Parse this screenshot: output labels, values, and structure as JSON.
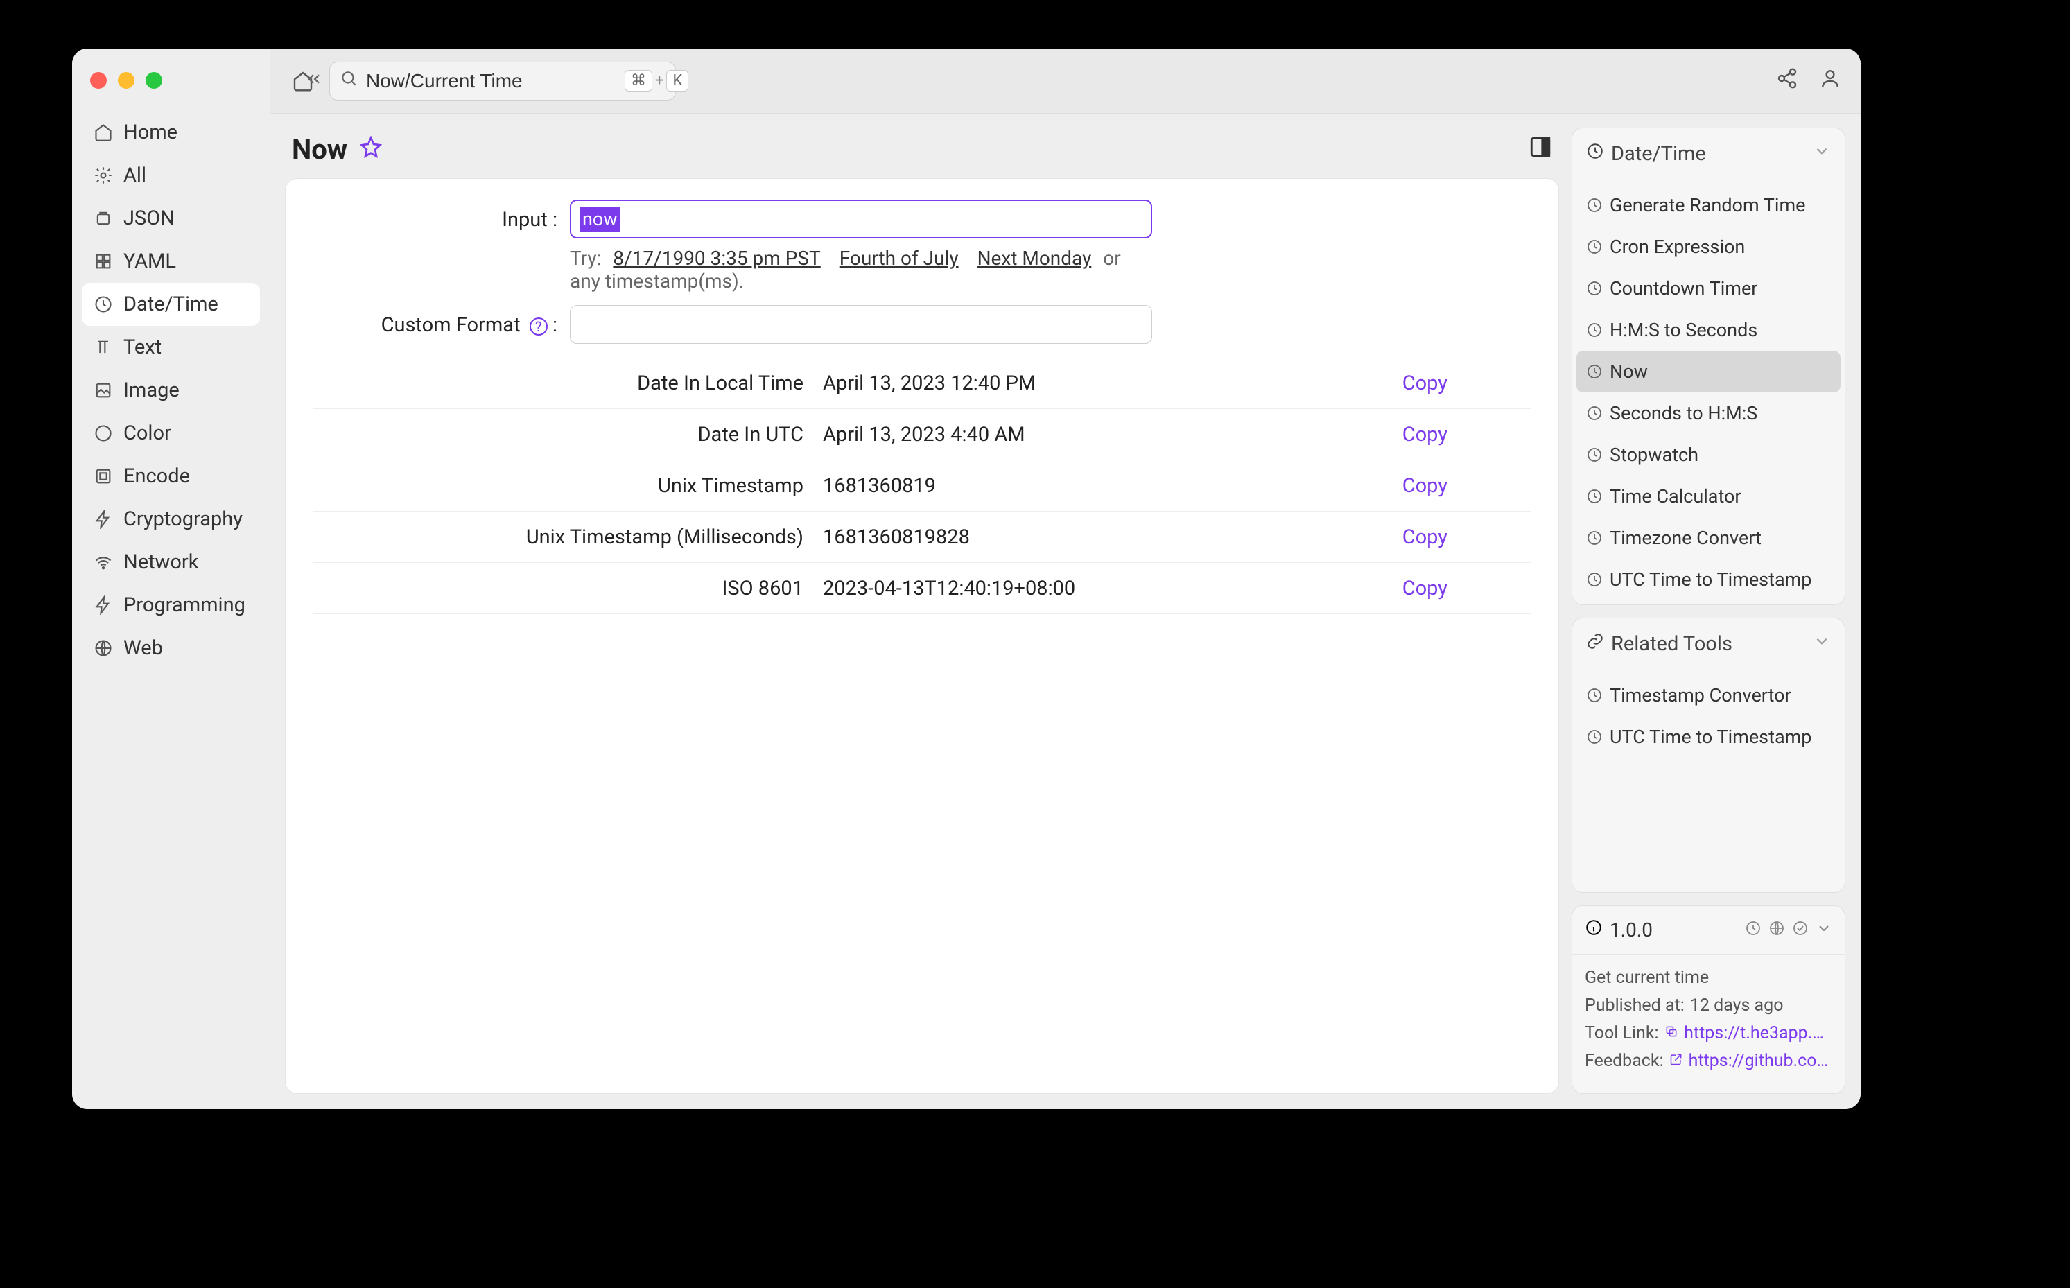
{
  "search": {
    "value": "Now/Current Time",
    "kbd1": "⌘",
    "plus": "+",
    "kbd2": "K"
  },
  "page": {
    "title": "Now"
  },
  "sidebar": {
    "items": [
      {
        "label": "Home"
      },
      {
        "label": "All"
      },
      {
        "label": "JSON"
      },
      {
        "label": "YAML"
      },
      {
        "label": "Date/Time"
      },
      {
        "label": "Text"
      },
      {
        "label": "Image"
      },
      {
        "label": "Color"
      },
      {
        "label": "Encode"
      },
      {
        "label": "Cryptography"
      },
      {
        "label": "Network"
      },
      {
        "label": "Programming"
      },
      {
        "label": "Web"
      }
    ]
  },
  "form": {
    "input_label": "Input :",
    "input_value": "now",
    "hint_prefix": "Try:",
    "hint_links": [
      "8/17/1990 3:35 pm PST",
      "Fourth of July",
      "Next Monday"
    ],
    "hint_suffix": " or any timestamp(ms).",
    "custom_format_label": "Custom Format",
    "custom_format_value": ""
  },
  "results": [
    {
      "label": "Date In Local Time",
      "value": "April 13, 2023 12:40 PM",
      "action": "Copy"
    },
    {
      "label": "Date In UTC",
      "value": "April 13, 2023 4:40 AM",
      "action": "Copy"
    },
    {
      "label": "Unix Timestamp",
      "value": "1681360819",
      "action": "Copy"
    },
    {
      "label": "Unix Timestamp (Milliseconds)",
      "value": "1681360819828",
      "action": "Copy"
    },
    {
      "label": "ISO 8601",
      "value": "2023-04-13T12:40:19+08:00",
      "action": "Copy"
    }
  ],
  "datetime_panel": {
    "title": "Date/Time",
    "items": [
      "Generate Random Time",
      "Cron Expression",
      "Countdown Timer",
      "H:M:S to Seconds",
      "Now",
      "Seconds to H:M:S",
      "Stopwatch",
      "Time Calculator",
      "Timezone Convert",
      "UTC Time to Timestamp"
    ],
    "active_index": 4
  },
  "related_panel": {
    "title": "Related Tools",
    "items": [
      "Timestamp Convertor",
      "UTC Time to Timestamp"
    ]
  },
  "info": {
    "version": "1.0.0",
    "description": "Get current time",
    "published_label": "Published at:",
    "published_value": "12 days ago",
    "tool_link_label": "Tool Link:",
    "tool_link_value": "https://t.he3app.co…",
    "feedback_label": "Feedback:",
    "feedback_value": "https://github.com/…"
  }
}
